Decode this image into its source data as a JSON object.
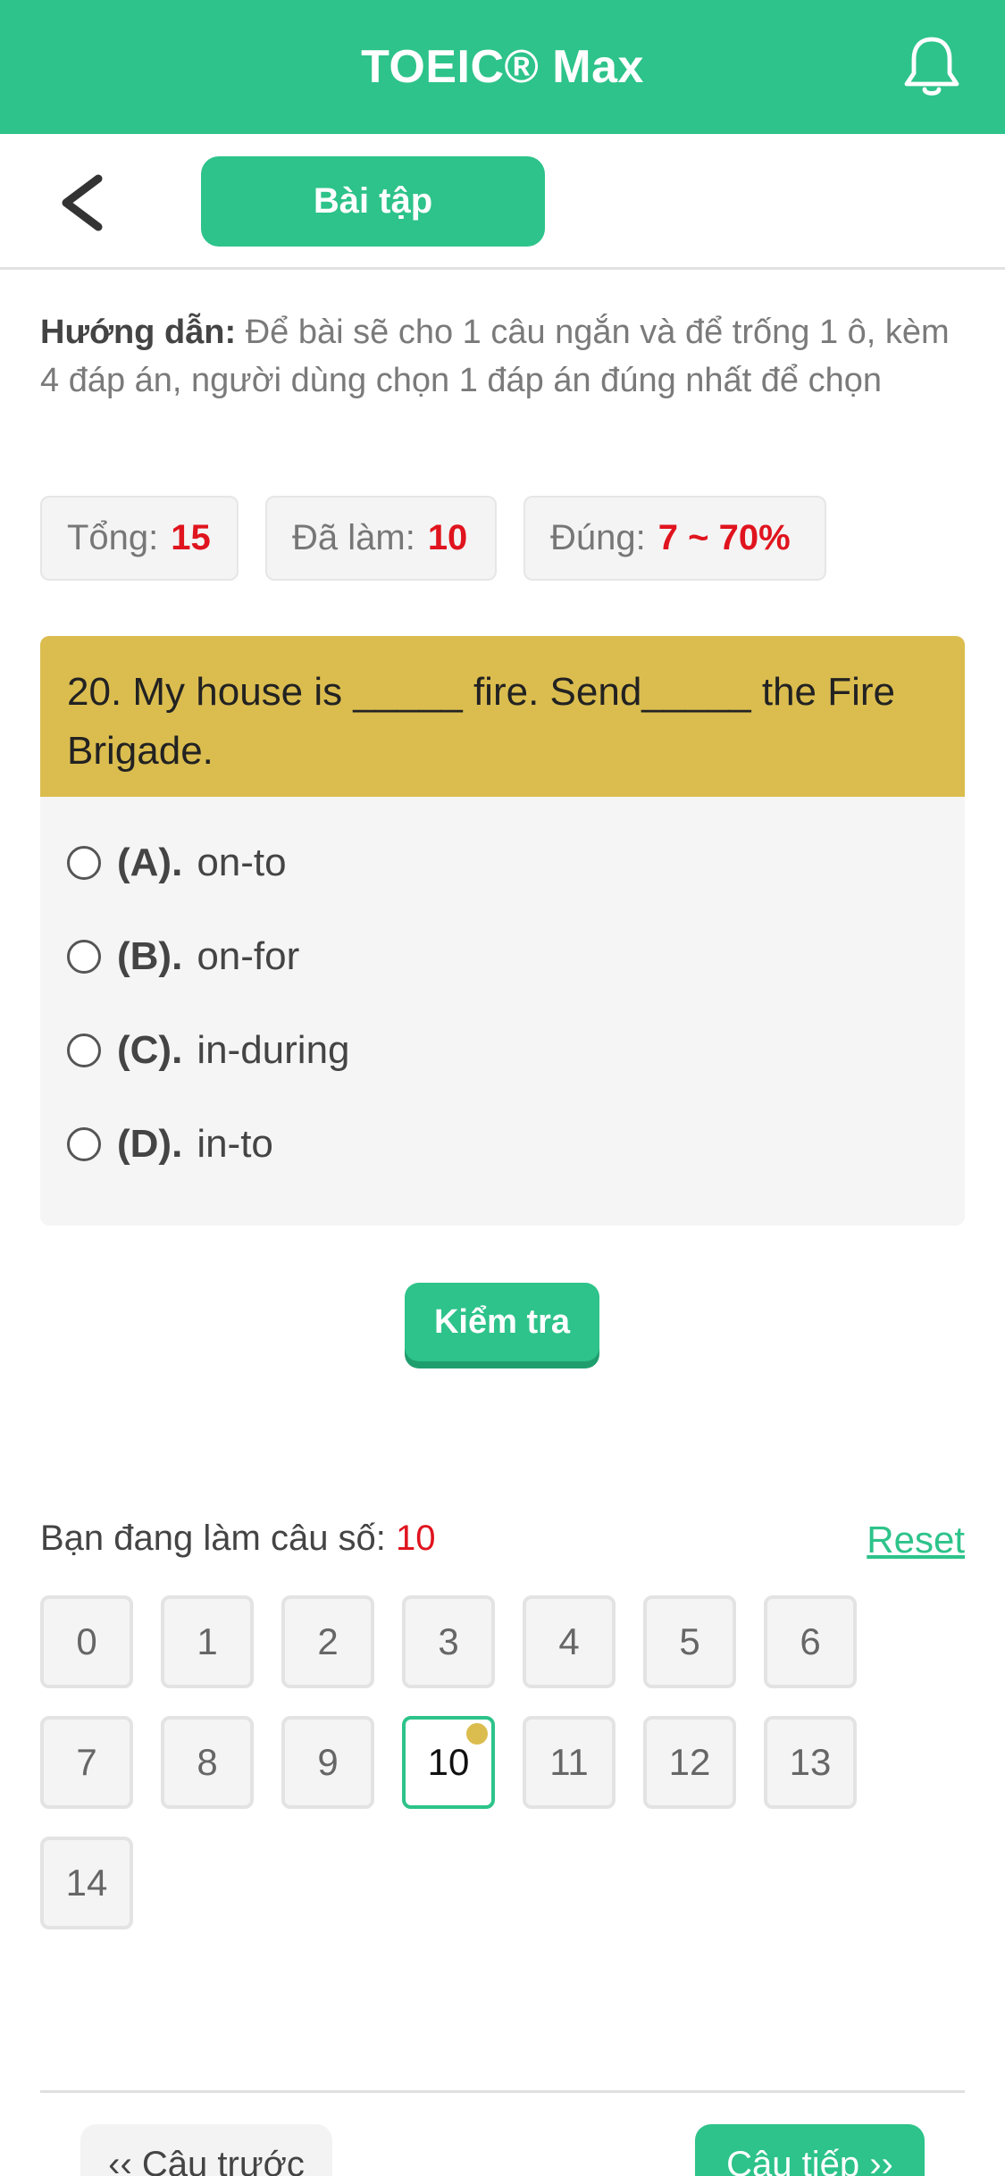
{
  "header": {
    "title": "TOEIC® Max",
    "bell_icon": "bell-icon"
  },
  "subnav": {
    "back_icon": "chevron-left-icon",
    "tab_label": "Bài tập"
  },
  "instructions": {
    "label": "Hướng dẫn:",
    "text": "Để bài sẽ cho 1 câu ngắn và để trống 1 ô, kèm 4 đáp án, người dùng chọn 1 đáp án đúng nhất để chọn"
  },
  "stats": {
    "total_label": "Tổng:",
    "total_value": "15",
    "done_label": "Đã làm:",
    "done_value": "10",
    "correct_label": "Đúng:",
    "correct_value": "7 ~ 70%"
  },
  "question": {
    "text": "20. My house is _____ fire. Send_____ the Fire Brigade.",
    "options": [
      {
        "letter": "(A).",
        "text": "on-to"
      },
      {
        "letter": "(B).",
        "text": "on-for"
      },
      {
        "letter": "(C).",
        "text": "in-during"
      },
      {
        "letter": "(D).",
        "text": "in-to"
      }
    ]
  },
  "check_button": "Kiểm tra",
  "progress": {
    "current_label": "Bạn đang làm câu số:",
    "current_value": "10",
    "reset_label": "Reset",
    "numbers": [
      "0",
      "1",
      "2",
      "3",
      "4",
      "5",
      "6",
      "7",
      "8",
      "9",
      "10",
      "11",
      "12",
      "13",
      "14"
    ],
    "active": "10"
  },
  "footer": {
    "prev_label": "‹‹ Câu trước",
    "next_label": "Câu tiếp ››"
  },
  "colors": {
    "primary": "#2dc38a",
    "question_bg": "#dbbd4f",
    "accent_red": "#e0141e"
  }
}
